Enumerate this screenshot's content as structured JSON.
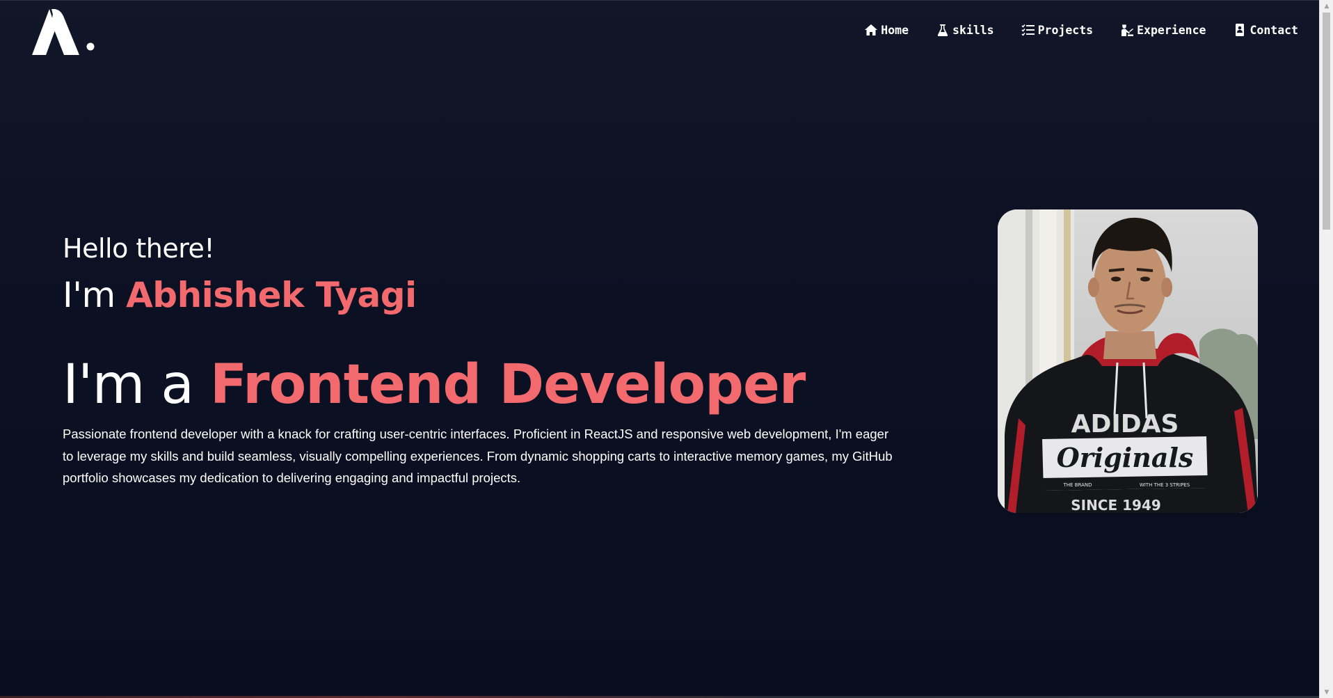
{
  "brand": {
    "logo_name": "logo-icon"
  },
  "nav": {
    "items": [
      {
        "label": "Home",
        "icon": "home-icon"
      },
      {
        "label": "skills",
        "icon": "flask-icon"
      },
      {
        "label": "Projects",
        "icon": "list-check-icon"
      },
      {
        "label": "Experience",
        "icon": "worker-icon"
      },
      {
        "label": "Contact",
        "icon": "contact-card-icon"
      }
    ]
  },
  "hero": {
    "greeting": "Hello there!",
    "im_prefix": "I'm ",
    "name": "Abhishek Tyagi",
    "role_prefix": "I'm a ",
    "role": "Frontend Developer",
    "bio": "Passionate frontend developer with a knack for crafting user-centric interfaces. Proficient in ReactJS and responsive web development, I'm eager to leverage my skills and build seamless, visually compelling experiences. From dynamic shopping carts to interactive memory games, my GitHub portfolio showcases my dedication to delivering engaging and impactful projects."
  },
  "profile": {
    "shirt_brand": "ADIDAS",
    "shirt_script": "Originals",
    "shirt_small_left": "THE BRAND",
    "shirt_small_right": "WITH THE 3 STRIPES",
    "shirt_since": "SINCE 1949"
  },
  "colors": {
    "accent": "#f26a6e",
    "background": "#0c1124",
    "text": "#ffffff"
  }
}
